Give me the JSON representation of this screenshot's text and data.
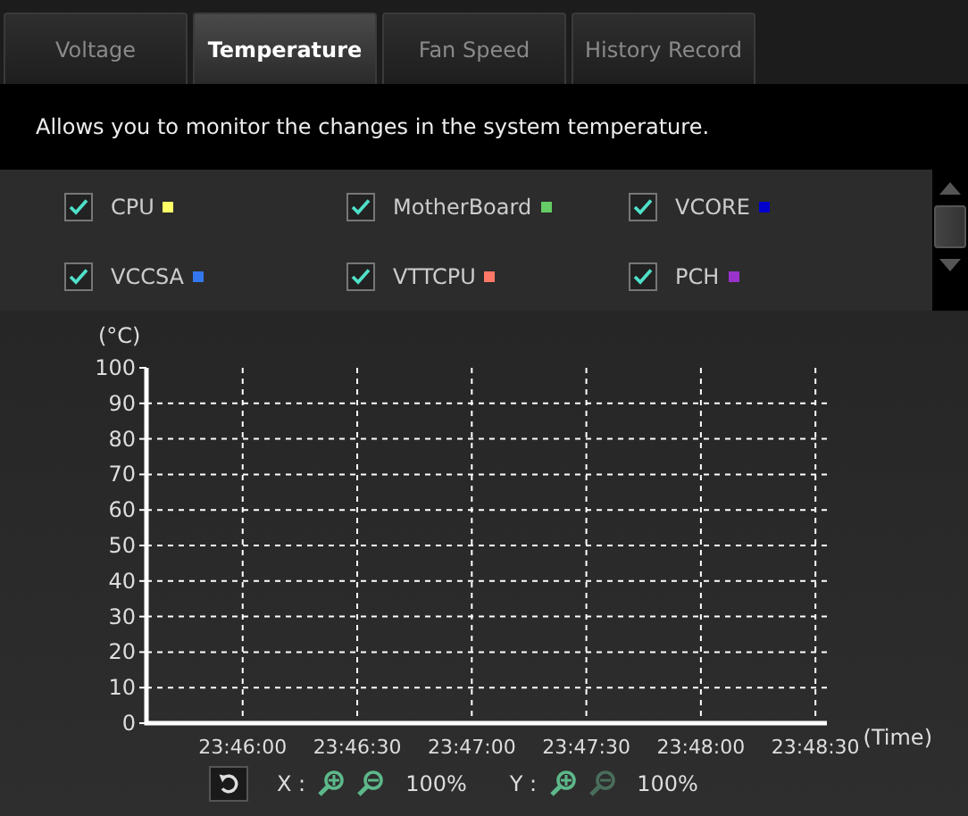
{
  "tabs": [
    {
      "label": "Voltage",
      "selected": false
    },
    {
      "label": "Temperature",
      "selected": true
    },
    {
      "label": "Fan Speed",
      "selected": false
    },
    {
      "label": "History Record",
      "selected": false
    }
  ],
  "description": "Allows you to monitor the changes in the system temperature.",
  "sensors": [
    {
      "label": "CPU",
      "checked": true,
      "color": "#ffff66"
    },
    {
      "label": "MotherBoard",
      "checked": true,
      "color": "#66cc66"
    },
    {
      "label": "VCORE",
      "checked": true,
      "color": "#0000cc"
    },
    {
      "label": "VCCSA",
      "checked": true,
      "color": "#3377ee"
    },
    {
      "label": "VTTCPU",
      "checked": true,
      "color": "#ff7766"
    },
    {
      "label": "PCH",
      "checked": true,
      "color": "#9933cc"
    }
  ],
  "chart": {
    "chart_data": {
      "type": "line",
      "grid": true,
      "ylabel": "(°C)",
      "xlabel": "(Time)",
      "ylim": [
        0,
        100
      ],
      "yticks": [
        0,
        10,
        20,
        30,
        40,
        50,
        60,
        70,
        80,
        90,
        100
      ],
      "categories": [
        "23:46:00",
        "23:46:30",
        "23:47:00",
        "23:47:30",
        "23:48:00",
        "23:48:30"
      ]
    }
  },
  "zoom": {
    "x_label": "X :",
    "x_percent": "100%",
    "y_label": "Y :",
    "y_percent": "100%"
  }
}
